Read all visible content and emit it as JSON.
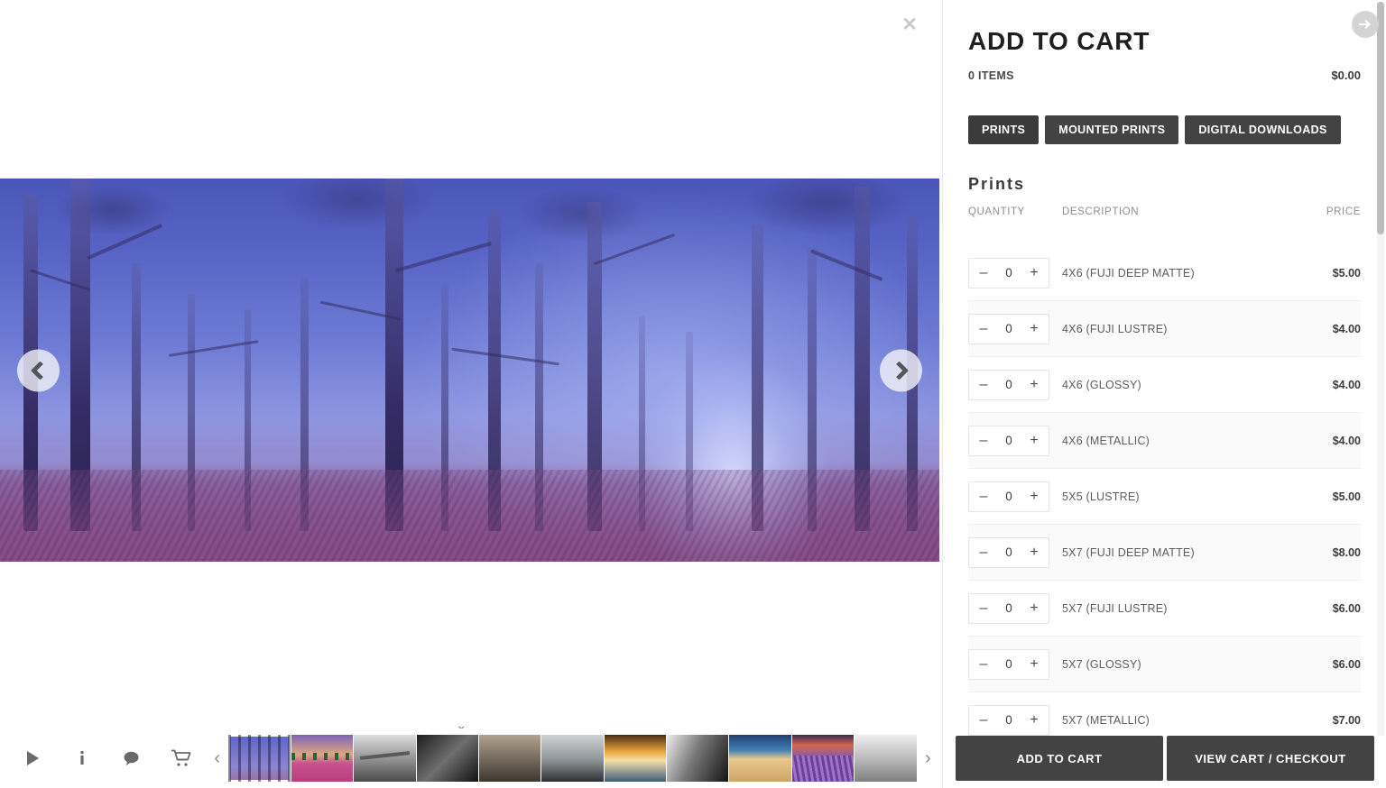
{
  "viewer": {
    "close_label": "✕",
    "prev_label": "prev-image",
    "next_label": "next-image",
    "down_chevron": "⌄",
    "thumb_prev": "‹",
    "thumb_next": "›",
    "tools": [
      {
        "name": "play-icon",
        "label": "Slideshow"
      },
      {
        "name": "info-icon",
        "label": "Info"
      },
      {
        "name": "comment-icon",
        "label": "Comments"
      },
      {
        "name": "cart-icon",
        "label": "Cart"
      }
    ],
    "thumbnails": [
      {
        "alt": "Blue misty forest",
        "active": true
      },
      {
        "alt": "Pink wildflower field at dusk"
      },
      {
        "alt": "Black and white pier"
      },
      {
        "alt": "Dark mountain canyon"
      },
      {
        "alt": "Sepia valley cliffs"
      },
      {
        "alt": "Grey rocky shoreline"
      },
      {
        "alt": "Golden sunset over sea"
      },
      {
        "alt": "Black and white rock abstract"
      },
      {
        "alt": "Sunset beach horizon"
      },
      {
        "alt": "Lavender field at sunset"
      },
      {
        "alt": "Monochrome pier long exposure"
      }
    ]
  },
  "cart": {
    "toggle_label": "collapse-panel",
    "title": "ADD TO CART",
    "items_count": "0 ITEMS",
    "total": "$0.00",
    "tabs": [
      {
        "label": "PRINTS",
        "active": true
      },
      {
        "label": "MOUNTED PRINTS",
        "active": false
      },
      {
        "label": "DIGITAL DOWNLOADS",
        "active": false
      }
    ],
    "section_title": "Prints",
    "columns": {
      "quantity": "QUANTITY",
      "description": "DESCRIPTION",
      "price": "PRICE"
    },
    "stepper": {
      "minus": "–",
      "plus": "+"
    },
    "products": [
      {
        "qty": "0",
        "description": "4X6 (FUJI DEEP MATTE)",
        "price": "$5.00"
      },
      {
        "qty": "0",
        "description": "4X6 (FUJI LUSTRE)",
        "price": "$4.00"
      },
      {
        "qty": "0",
        "description": "4X6 (GLOSSY)",
        "price": "$4.00"
      },
      {
        "qty": "0",
        "description": "4X6 (METALLIC)",
        "price": "$4.00"
      },
      {
        "qty": "0",
        "description": "5X5 (LUSTRE)",
        "price": "$5.00"
      },
      {
        "qty": "0",
        "description": "5X7 (FUJI DEEP MATTE)",
        "price": "$8.00"
      },
      {
        "qty": "0",
        "description": "5X7 (FUJI LUSTRE)",
        "price": "$6.00"
      },
      {
        "qty": "0",
        "description": "5X7 (GLOSSY)",
        "price": "$6.00"
      },
      {
        "qty": "0",
        "description": "5X7 (METALLIC)",
        "price": "$7.00"
      }
    ],
    "actions": {
      "add_to_cart": "ADD TO CART",
      "view_cart": "VIEW CART / CHECKOUT"
    }
  },
  "colors": {
    "button_dark": "#434343",
    "text_dark": "#1f1f1f",
    "muted": "#8e8e8e",
    "row_alt": "#fafafa",
    "scrollbar": "#bdbdbd"
  }
}
